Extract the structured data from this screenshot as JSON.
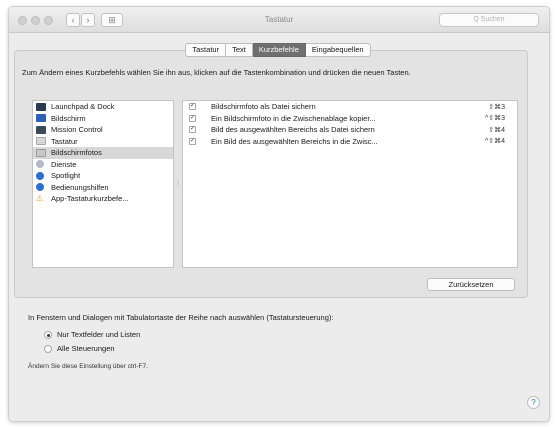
{
  "window": {
    "title": "Tastatur",
    "search_placeholder": "Q Suchen",
    "nav_back": "‹",
    "nav_forward": "›",
    "grid_icon": "⊞"
  },
  "tabs": [
    {
      "label": "Tastatur",
      "active": false
    },
    {
      "label": "Text",
      "active": false
    },
    {
      "label": "Kurzbefehle",
      "active": true
    },
    {
      "label": "Eingabequellen",
      "active": false
    }
  ],
  "instruction": "Zum Ändern eines Kurzbefehls wählen Sie ihn aus, klicken auf die Tastenkombination und drücken die neuen Tasten.",
  "categories": [
    {
      "label": "Launchpad & Dock",
      "icon": "launchpad-icon",
      "selected": false
    },
    {
      "label": "Bildschirm",
      "icon": "display-icon",
      "selected": false
    },
    {
      "label": "Mission Control",
      "icon": "mission-control-icon",
      "selected": false
    },
    {
      "label": "Tastatur",
      "icon": "keyboard-icon",
      "selected": false
    },
    {
      "label": "Bildschirmfotos",
      "icon": "screenshot-icon",
      "selected": true
    },
    {
      "label": "Dienste",
      "icon": "services-icon",
      "selected": false
    },
    {
      "label": "Spotlight",
      "icon": "spotlight-icon",
      "selected": false
    },
    {
      "label": "Bedienungshilfen",
      "icon": "accessibility-icon",
      "selected": false
    },
    {
      "label": "App-Tastaturkurzbefe...",
      "icon": "app-shortcuts-icon",
      "selected": false
    }
  ],
  "shortcuts": [
    {
      "checked": true,
      "label": "Bildschirmfoto als Datei sichern",
      "keys": "⇧⌘3"
    },
    {
      "checked": true,
      "label": "Ein Bildschirmfoto in die Zwischenablage kopier...",
      "keys": "^⇧⌘3"
    },
    {
      "checked": true,
      "label": "Bild des ausgewählten Bereichs als Datei sichern",
      "keys": "⇧⌘4"
    },
    {
      "checked": true,
      "label": "Ein Bild des ausgewählten Bereichs in die Zwisc...",
      "keys": "^⇧⌘4"
    }
  ],
  "reset_button": "Zurücksetzen",
  "tab_navigation": {
    "label": "In Fenstern und Dialogen mit Tabulatortaste der Reihe nach auswählen (Tastatursteuerung):",
    "options": [
      {
        "label": "Nur Textfelder und Listen",
        "selected": true
      },
      {
        "label": "Alle Steuerungen",
        "selected": false
      }
    ],
    "hint": "Ändern Sie diese Einstellung über ctrl-F7."
  },
  "help_button": "?"
}
